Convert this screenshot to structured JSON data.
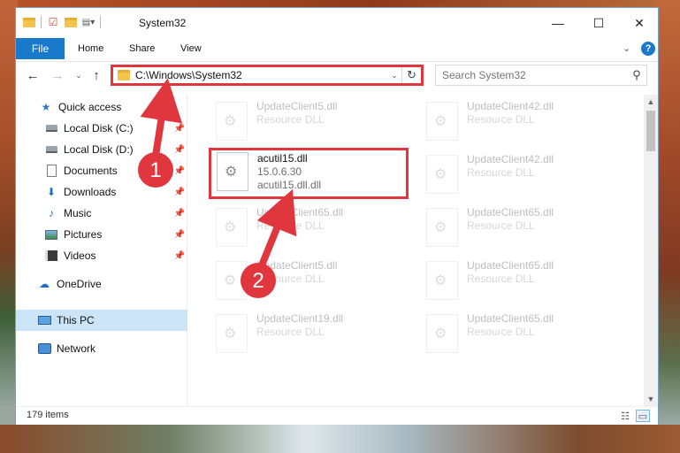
{
  "window": {
    "title": "System32",
    "controls": {
      "minimize": "—",
      "maximize": "☐",
      "close": "✕"
    }
  },
  "ribbon": {
    "tabs": [
      "File",
      "Home",
      "Share",
      "View"
    ],
    "expand_glyph": "⌄",
    "help_glyph": "?"
  },
  "navigation": {
    "back_glyph": "←",
    "forward_glyph": "→",
    "recent_glyph": "⌄",
    "up_glyph": "↑",
    "address_path": "C:\\Windows\\System32",
    "dropdown_glyph": "⌄",
    "refresh_glyph": "↻",
    "search_placeholder": "Search System32",
    "search_glyph": "⚲"
  },
  "sidebar": {
    "items": [
      {
        "label": "Quick access",
        "icon": "star-icon",
        "pinned": false
      },
      {
        "label": "Local Disk (C:)",
        "icon": "disk-icon",
        "pinned": true
      },
      {
        "label": "Local Disk (D:)",
        "icon": "disk-icon",
        "pinned": true
      },
      {
        "label": "Documents",
        "icon": "documents-icon",
        "pinned": true
      },
      {
        "label": "Downloads",
        "icon": "downloads-icon",
        "pinned": true
      },
      {
        "label": "Music",
        "icon": "music-icon",
        "pinned": true
      },
      {
        "label": "Pictures",
        "icon": "pictures-icon",
        "pinned": true
      },
      {
        "label": "Videos",
        "icon": "videos-icon",
        "pinned": true
      },
      {
        "label": "OneDrive",
        "icon": "onedrive-icon",
        "pinned": false
      },
      {
        "label": "This PC",
        "icon": "this-pc-icon",
        "pinned": false,
        "selected": true
      },
      {
        "label": "Network",
        "icon": "network-icon",
        "pinned": false
      }
    ],
    "pin_glyph": "📌"
  },
  "files": {
    "highlighted": {
      "name": "acutil15.dll",
      "version": "15.0.6.30",
      "description": "acutil15.dll.dll"
    },
    "tiles_left": [
      {
        "name": "UpdateClient5.dll",
        "type": "Resource DLL"
      },
      {
        "name": "UpdateClient65.dll",
        "type": "Resource DLL"
      },
      {
        "name": "UpdateClient5.dll",
        "type": "Resource DLL"
      },
      {
        "name": "UpdateClient19.dll",
        "type": "Resource DLL"
      }
    ],
    "tiles_right": [
      {
        "name": "UpdateClient42.dll",
        "type": "Resource DLL"
      },
      {
        "name": "UpdateClient42.dll",
        "type": "Resource DLL"
      },
      {
        "name": "UpdateClient65.dll",
        "type": "Resource DLL"
      },
      {
        "name": "UpdateClient65.dll",
        "type": "Resource DLL"
      },
      {
        "name": "UpdateClient65.dll",
        "type": "Resource DLL"
      }
    ]
  },
  "statusbar": {
    "item_count": "179 items"
  },
  "annotations": {
    "step1": "1",
    "step2": "2",
    "color": "#e0373f"
  }
}
